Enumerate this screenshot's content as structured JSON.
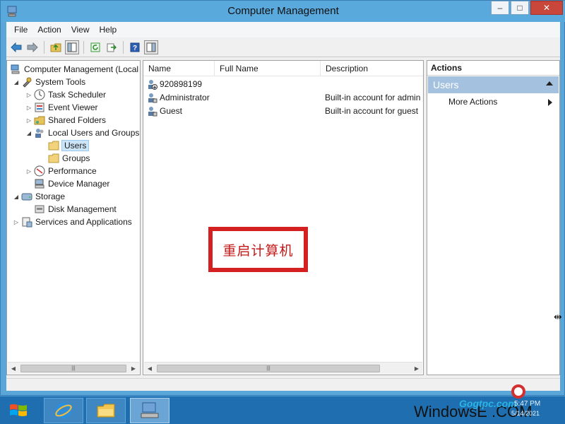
{
  "window": {
    "title": "Computer Management",
    "controls": {
      "minimize": "–",
      "maximize": "□",
      "close": "✕"
    }
  },
  "menubar": {
    "items": [
      "File",
      "Action",
      "View",
      "Help"
    ]
  },
  "toolbar": {
    "buttons": [
      "back-arrow-icon",
      "forward-arrow-icon",
      "up-folder-icon",
      "show-hide-console-tree-icon",
      "refresh-icon",
      "export-list-icon",
      "help-icon",
      "show-hide-action-pane-icon"
    ]
  },
  "tree": {
    "items": [
      {
        "label": "Computer Management (Local",
        "icon": "computer-management-icon",
        "arrow": ""
      },
      {
        "label": "System Tools",
        "icon": "system-tools-icon",
        "arrow": "expanded"
      },
      {
        "label": "Task Scheduler",
        "icon": "task-scheduler-icon",
        "arrow": "collapsed"
      },
      {
        "label": "Event Viewer",
        "icon": "event-viewer-icon",
        "arrow": "collapsed"
      },
      {
        "label": "Shared Folders",
        "icon": "shared-folders-icon",
        "arrow": "collapsed"
      },
      {
        "label": "Local Users and Groups",
        "icon": "local-users-groups-icon",
        "arrow": "expanded"
      },
      {
        "label": "Users",
        "icon": "folder-icon",
        "arrow": "",
        "selected": true
      },
      {
        "label": "Groups",
        "icon": "folder-icon",
        "arrow": ""
      },
      {
        "label": "Performance",
        "icon": "performance-icon",
        "arrow": "collapsed"
      },
      {
        "label": "Device Manager",
        "icon": "device-manager-icon",
        "arrow": ""
      },
      {
        "label": "Storage",
        "icon": "storage-icon",
        "arrow": "expanded"
      },
      {
        "label": "Disk Management",
        "icon": "disk-management-icon",
        "arrow": ""
      },
      {
        "label": "Services and Applications",
        "icon": "services-applications-icon",
        "arrow": "collapsed"
      }
    ]
  },
  "list": {
    "columns": [
      "Name",
      "Full Name",
      "Description"
    ],
    "rows": [
      {
        "name": "920898199",
        "full_name": "",
        "description": "",
        "icon": "user-disabled-icon"
      },
      {
        "name": "Administrator",
        "full_name": "",
        "description": "Built-in account for admin",
        "icon": "user-icon"
      },
      {
        "name": "Guest",
        "full_name": "",
        "description": "Built-in account for guest",
        "icon": "user-icon"
      }
    ]
  },
  "actions": {
    "title": "Actions",
    "section": "Users",
    "items": [
      "More Actions"
    ]
  },
  "overlay": {
    "text": "重启计算机",
    "color": "#d42020"
  },
  "taskbar": {
    "buttons": [
      "internet-explorer-icon",
      "file-explorer-icon",
      "computer-management-taskbar-icon"
    ],
    "watermark": "WindowsE     .COM",
    "tray_logo": "Gogtpc.com",
    "time": "5:47 PM",
    "date": "5/14/2021"
  },
  "colors": {
    "title_bar": "#59a9dd",
    "taskbar": "#1f6fb0",
    "actions_section": "#a4c2e0",
    "selection": "#cce4f7"
  }
}
